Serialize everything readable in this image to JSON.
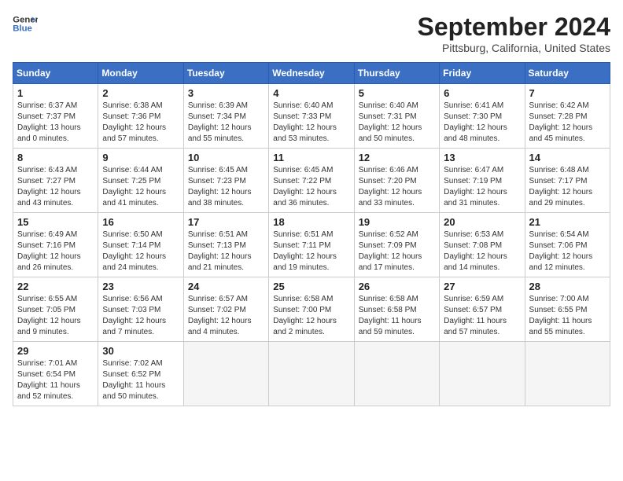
{
  "header": {
    "logo_line1": "General",
    "logo_line2": "Blue",
    "title": "September 2024",
    "location": "Pittsburg, California, United States"
  },
  "columns": [
    "Sunday",
    "Monday",
    "Tuesday",
    "Wednesday",
    "Thursday",
    "Friday",
    "Saturday"
  ],
  "weeks": [
    [
      {
        "day": "1",
        "lines": [
          "Sunrise: 6:37 AM",
          "Sunset: 7:37 PM",
          "Daylight: 13 hours",
          "and 0 minutes."
        ]
      },
      {
        "day": "2",
        "lines": [
          "Sunrise: 6:38 AM",
          "Sunset: 7:36 PM",
          "Daylight: 12 hours",
          "and 57 minutes."
        ]
      },
      {
        "day": "3",
        "lines": [
          "Sunrise: 6:39 AM",
          "Sunset: 7:34 PM",
          "Daylight: 12 hours",
          "and 55 minutes."
        ]
      },
      {
        "day": "4",
        "lines": [
          "Sunrise: 6:40 AM",
          "Sunset: 7:33 PM",
          "Daylight: 12 hours",
          "and 53 minutes."
        ]
      },
      {
        "day": "5",
        "lines": [
          "Sunrise: 6:40 AM",
          "Sunset: 7:31 PM",
          "Daylight: 12 hours",
          "and 50 minutes."
        ]
      },
      {
        "day": "6",
        "lines": [
          "Sunrise: 6:41 AM",
          "Sunset: 7:30 PM",
          "Daylight: 12 hours",
          "and 48 minutes."
        ]
      },
      {
        "day": "7",
        "lines": [
          "Sunrise: 6:42 AM",
          "Sunset: 7:28 PM",
          "Daylight: 12 hours",
          "and 45 minutes."
        ]
      }
    ],
    [
      {
        "day": "8",
        "lines": [
          "Sunrise: 6:43 AM",
          "Sunset: 7:27 PM",
          "Daylight: 12 hours",
          "and 43 minutes."
        ]
      },
      {
        "day": "9",
        "lines": [
          "Sunrise: 6:44 AM",
          "Sunset: 7:25 PM",
          "Daylight: 12 hours",
          "and 41 minutes."
        ]
      },
      {
        "day": "10",
        "lines": [
          "Sunrise: 6:45 AM",
          "Sunset: 7:23 PM",
          "Daylight: 12 hours",
          "and 38 minutes."
        ]
      },
      {
        "day": "11",
        "lines": [
          "Sunrise: 6:45 AM",
          "Sunset: 7:22 PM",
          "Daylight: 12 hours",
          "and 36 minutes."
        ]
      },
      {
        "day": "12",
        "lines": [
          "Sunrise: 6:46 AM",
          "Sunset: 7:20 PM",
          "Daylight: 12 hours",
          "and 33 minutes."
        ]
      },
      {
        "day": "13",
        "lines": [
          "Sunrise: 6:47 AM",
          "Sunset: 7:19 PM",
          "Daylight: 12 hours",
          "and 31 minutes."
        ]
      },
      {
        "day": "14",
        "lines": [
          "Sunrise: 6:48 AM",
          "Sunset: 7:17 PM",
          "Daylight: 12 hours",
          "and 29 minutes."
        ]
      }
    ],
    [
      {
        "day": "15",
        "lines": [
          "Sunrise: 6:49 AM",
          "Sunset: 7:16 PM",
          "Daylight: 12 hours",
          "and 26 minutes."
        ]
      },
      {
        "day": "16",
        "lines": [
          "Sunrise: 6:50 AM",
          "Sunset: 7:14 PM",
          "Daylight: 12 hours",
          "and 24 minutes."
        ]
      },
      {
        "day": "17",
        "lines": [
          "Sunrise: 6:51 AM",
          "Sunset: 7:13 PM",
          "Daylight: 12 hours",
          "and 21 minutes."
        ]
      },
      {
        "day": "18",
        "lines": [
          "Sunrise: 6:51 AM",
          "Sunset: 7:11 PM",
          "Daylight: 12 hours",
          "and 19 minutes."
        ]
      },
      {
        "day": "19",
        "lines": [
          "Sunrise: 6:52 AM",
          "Sunset: 7:09 PM",
          "Daylight: 12 hours",
          "and 17 minutes."
        ]
      },
      {
        "day": "20",
        "lines": [
          "Sunrise: 6:53 AM",
          "Sunset: 7:08 PM",
          "Daylight: 12 hours",
          "and 14 minutes."
        ]
      },
      {
        "day": "21",
        "lines": [
          "Sunrise: 6:54 AM",
          "Sunset: 7:06 PM",
          "Daylight: 12 hours",
          "and 12 minutes."
        ]
      }
    ],
    [
      {
        "day": "22",
        "lines": [
          "Sunrise: 6:55 AM",
          "Sunset: 7:05 PM",
          "Daylight: 12 hours",
          "and 9 minutes."
        ]
      },
      {
        "day": "23",
        "lines": [
          "Sunrise: 6:56 AM",
          "Sunset: 7:03 PM",
          "Daylight: 12 hours",
          "and 7 minutes."
        ]
      },
      {
        "day": "24",
        "lines": [
          "Sunrise: 6:57 AM",
          "Sunset: 7:02 PM",
          "Daylight: 12 hours",
          "and 4 minutes."
        ]
      },
      {
        "day": "25",
        "lines": [
          "Sunrise: 6:58 AM",
          "Sunset: 7:00 PM",
          "Daylight: 12 hours",
          "and 2 minutes."
        ]
      },
      {
        "day": "26",
        "lines": [
          "Sunrise: 6:58 AM",
          "Sunset: 6:58 PM",
          "Daylight: 11 hours",
          "and 59 minutes."
        ]
      },
      {
        "day": "27",
        "lines": [
          "Sunrise: 6:59 AM",
          "Sunset: 6:57 PM",
          "Daylight: 11 hours",
          "and 57 minutes."
        ]
      },
      {
        "day": "28",
        "lines": [
          "Sunrise: 7:00 AM",
          "Sunset: 6:55 PM",
          "Daylight: 11 hours",
          "and 55 minutes."
        ]
      }
    ],
    [
      {
        "day": "29",
        "lines": [
          "Sunrise: 7:01 AM",
          "Sunset: 6:54 PM",
          "Daylight: 11 hours",
          "and 52 minutes."
        ]
      },
      {
        "day": "30",
        "lines": [
          "Sunrise: 7:02 AM",
          "Sunset: 6:52 PM",
          "Daylight: 11 hours",
          "and 50 minutes."
        ]
      },
      null,
      null,
      null,
      null,
      null
    ]
  ]
}
